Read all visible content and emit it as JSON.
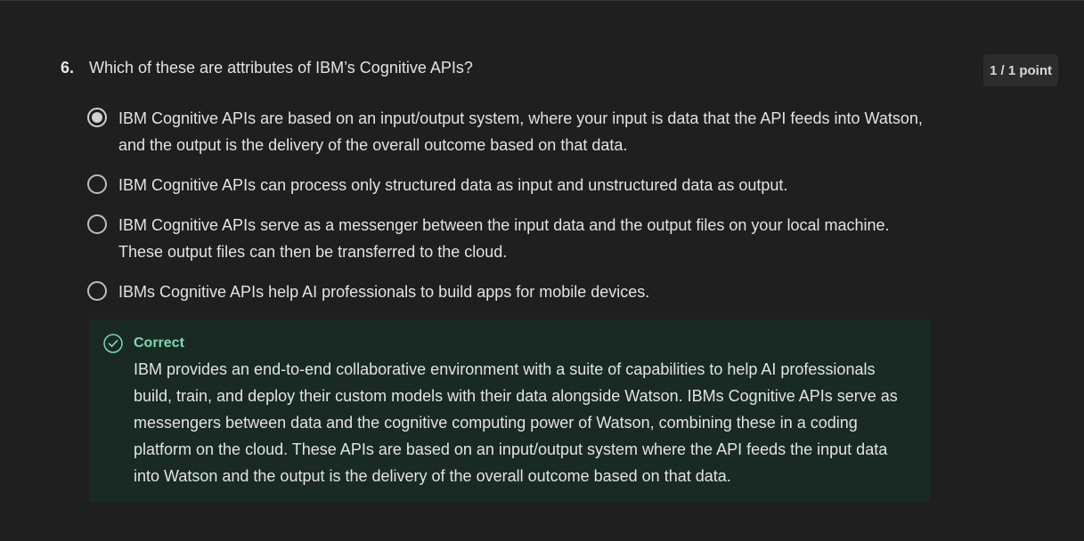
{
  "question": {
    "number": "6.",
    "text": "Which of these are attributes of IBM’s Cognitive APIs?",
    "score": "1 / 1 point"
  },
  "options": [
    {
      "text": "IBM Cognitive APIs are based on an input/output system, where your input is data that the API feeds into Watson, and the output is the delivery of the overall outcome based on that data.",
      "selected": true
    },
    {
      "text": "IBM Cognitive APIs can process only structured data as input and unstructured data as output.",
      "selected": false
    },
    {
      "text": "IBM Cognitive APIs serve as a messenger between the input data and the output files on your local machine. These output files can then be transferred to the cloud.",
      "selected": false
    },
    {
      "text": "IBMs Cognitive APIs help AI professionals to build apps for mobile devices.",
      "selected": false
    }
  ],
  "feedback": {
    "icon": "check-circle-icon",
    "status": "Correct",
    "status_color": "#7fd8b2",
    "body": "IBM provides an end-to-end collaborative environment with a suite of capabilities to help AI professionals build, train, and deploy their custom models with their data alongside Watson. IBMs Cognitive APIs serve as messengers between data and the cognitive computing power of Watson, combining these in a coding platform on the cloud. These APIs are based on an input/output system where the API feeds the input data into Watson and the output is the delivery of the overall outcome based on that data."
  }
}
